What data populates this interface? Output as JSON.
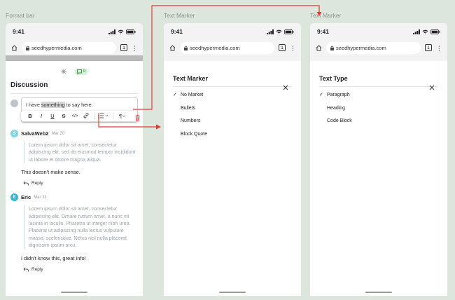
{
  "frames": [
    {
      "label": "Format bar"
    },
    {
      "label": "Text Marker"
    },
    {
      "label": "Text Marker"
    }
  ],
  "device": {
    "time": "9:41",
    "url": "seedhypermedia.com",
    "tab_count": "1"
  },
  "discussion": {
    "comment_count": "0",
    "title": "Discussion",
    "compose": {
      "before": "I have ",
      "selected": "something",
      "after": " to say here."
    },
    "toolbar": {
      "bold": "B",
      "italic": "I",
      "underline": "U",
      "strike": "S",
      "code": "</>",
      "link": "link-icon",
      "list": "list-icon",
      "paragraph": "¶"
    },
    "comments": [
      {
        "initial": "S",
        "avatar_color": "#7fd6e0",
        "author": "SalvaWeb2",
        "date": "Mar 20",
        "quote": "Lorem ipsum dolor sit amet, consectetur adipiscing elit, sed do eiusmod tempor incididunt ut labore et dolore magna aliqua.",
        "text": "This doesn't make sense.",
        "reply": "Reply"
      },
      {
        "initial": "E",
        "avatar_color": "#35b7d4",
        "author": "Eric",
        "date": "Mar 31",
        "quote": "Lorem ipsum dolor sit amet, consectetur adipiscing elit. Ornare rutrum amet, a nunc mi lacinia in iaculis. Pharetra ut integer nibh urna. Placerat ut adipiscing nulla lectus vulputate massa, scelerisque. Netus nisl nulla placerat dignissim ipsum arcu.",
        "text": "I didn't know this, great info!",
        "reply": "Reply"
      }
    ]
  },
  "text_marker_sheet": {
    "title": "Text Marker",
    "options": [
      "No Market",
      "Bullets",
      "Numbers",
      "Block Quote"
    ],
    "selected": "No Market"
  },
  "text_type_sheet": {
    "title": "Text Type",
    "options": [
      "Paragraph",
      "Heading",
      "Code Block"
    ],
    "selected": "Paragraph"
  },
  "colors": {
    "background": "#dde6dd",
    "arrow": "#e53935",
    "badge_bg": "#d4f3d8"
  }
}
